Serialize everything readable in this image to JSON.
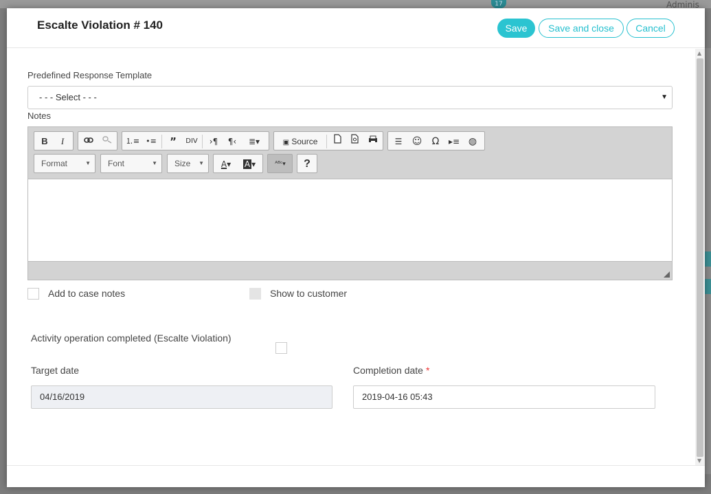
{
  "modal": {
    "title": "Escalte Violation # 140",
    "save_label": "Save",
    "save_close_label": "Save and close",
    "cancel_label": "Cancel"
  },
  "form": {
    "template_label": "Predefined Response Template",
    "template_value": "- - - Select - - -",
    "notes_label": "Notes",
    "add_case_notes_label": "Add to case notes",
    "show_customer_label": "Show to customer",
    "activity_completed_label": "Activity operation completed (Escalte Violation)",
    "target_date_label": "Target date",
    "target_date_value": "04/16/2019",
    "completion_date_label": "Completion date",
    "completion_required_mark": "*",
    "completion_date_value": "2019-04-16 05:43"
  },
  "editor_toolbar": {
    "source_label": "Source",
    "format_label": "Format",
    "font_label": "Font",
    "size_label": "Size",
    "help_label": "?"
  },
  "background": {
    "badge_count": "17",
    "user_label": "Adminis"
  }
}
